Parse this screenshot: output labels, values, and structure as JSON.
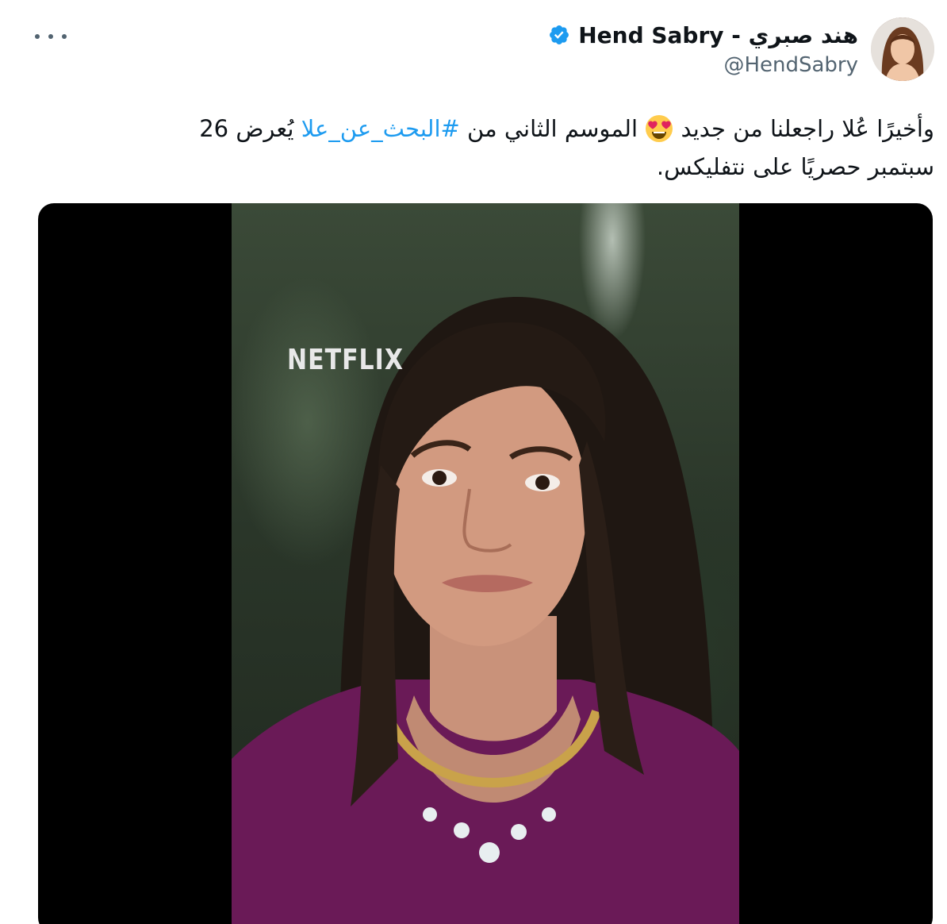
{
  "tweet": {
    "author": {
      "display_name": "Hend Sabry - هند صبري",
      "handle": "@HendSabry",
      "verified_icon": "verified-badge-icon",
      "avatar": "profile-avatar"
    },
    "more_icon": "more-options-icon",
    "text": {
      "line1_part1": "وأخيرًا عُلا راجعلنا من جديد",
      "emoji": "heart-eyes-emoji",
      "line1_part2": "الموسم الثاني من",
      "hashtag": "#البحث_عن_علا",
      "line1_part3": "يُعرض 26",
      "line2": "سبتمبر حصريًا على نتفليكس."
    },
    "media": {
      "logo_text": "NETFLIX"
    }
  },
  "colors": {
    "accent": "#1d9bf0",
    "text": "#0f1419",
    "secondary": "#536471"
  }
}
